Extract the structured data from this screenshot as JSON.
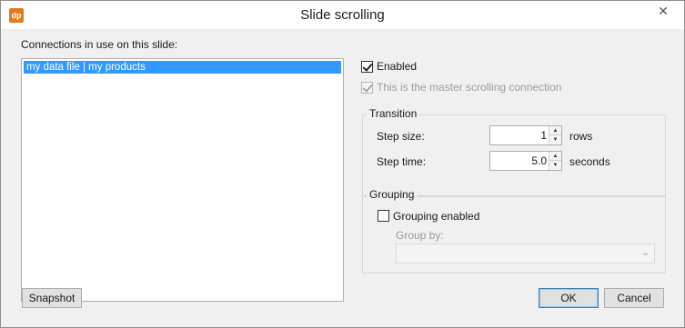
{
  "window": {
    "app_icon_text": "dp",
    "title": "Slide scrolling",
    "close_glyph": "✕"
  },
  "connections": {
    "label": "Connections in use on this slide:",
    "items": [
      "my data file | my products"
    ]
  },
  "options": {
    "enabled_label": "Enabled",
    "enabled_checked": true,
    "master_label": "This is the master scrolling connection",
    "master_checked": true
  },
  "transition": {
    "title": "Transition",
    "step_size_label": "Step size:",
    "step_size_value": "1",
    "step_size_unit": "rows",
    "step_time_label": "Step time:",
    "step_time_value": "5.0",
    "step_time_unit": "seconds"
  },
  "grouping": {
    "title": "Grouping",
    "enabled_label": "Grouping enabled",
    "enabled_checked": false,
    "group_by_label": "Group by:",
    "group_by_value": ""
  },
  "buttons": {
    "snapshot": "Snapshot",
    "ok": "OK",
    "cancel": "Cancel"
  }
}
